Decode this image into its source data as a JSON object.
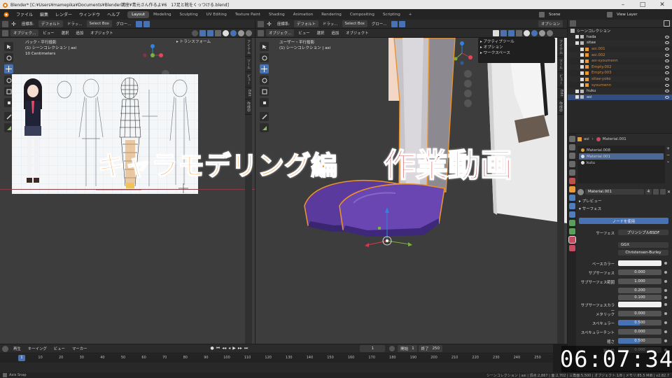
{
  "titlebar": {
    "title": "Blender* [C:¥Users¥mamepika¥Documents¥Blender講座¥青元さん作るよ¥6　17足と靴をくっつける.blend]"
  },
  "menubar": {
    "items": [
      "ファイル",
      "編集",
      "レンダー",
      "ウィンドウ",
      "ヘルプ"
    ],
    "workspaces": [
      "Layout",
      "Modeling",
      "Sculpting",
      "UV Editing",
      "Texture Paint",
      "Shading",
      "Animation",
      "Rendering",
      "Compositing",
      "Scripting",
      "+"
    ],
    "active_workspace": "Layout",
    "scene_label": "Scene",
    "view_layer_label": "View Layer"
  },
  "left_viewport": {
    "header": {
      "mode": "オブジェク…",
      "orientation_label": "座標系:",
      "orientation": "デフォルト",
      "drag": "ドラッ…",
      "select": "Select Box",
      "global": "グロー…",
      "menus": [
        "ビュー",
        "選択",
        "追加",
        "オブジェクト"
      ]
    },
    "info_lines": [
      "バック・平行投影",
      "(1) シーンコレクション | asi",
      "10 Centimeters"
    ],
    "transform_panel": "トランスフォーム",
    "side_tabs": [
      "アイテム",
      "ツール",
      "ビュー",
      "Edit",
      "作成中"
    ]
  },
  "right_viewport": {
    "header": {
      "mode": "オブジェク…",
      "orientation_label": "座標系:",
      "orientation": "デフォルト",
      "drag": "ドラッ…",
      "select": "Select Box",
      "global": "グロー…",
      "menus": [
        "ビュー",
        "選択",
        "追加",
        "オブジェクト"
      ],
      "options": "オプション"
    },
    "info_lines": [
      "ユーザー・平行投影",
      "(1) シーンコレクション | asi"
    ],
    "dropdown_items": [
      "アクティブツール",
      "オプション",
      "ワークスペース"
    ],
    "side_tabs": [
      "アイテム",
      "ツール",
      "ビュー",
      "Edit",
      "作成中"
    ]
  },
  "overlay": {
    "title_part1": "キャラモデリング編",
    "title_part2": "作業動画",
    "timestamp": "06:07:34"
  },
  "outliner": {
    "header": "シーンコレクション",
    "rows": [
      {
        "name": "hada",
        "indent": 1,
        "selected": false
      },
      {
        "name": "sitae",
        "indent": 1,
        "selected": false
      },
      {
        "name": "asi.001",
        "indent": 2,
        "selected": false
      },
      {
        "name": "asi.002",
        "indent": 2,
        "selected": false
      },
      {
        "name": "asi-syoumenn",
        "indent": 2,
        "selected": false
      },
      {
        "name": "Empty.002",
        "indent": 2,
        "selected": false
      },
      {
        "name": "Empty.003",
        "indent": 2,
        "selected": false
      },
      {
        "name": "sitae-yoko",
        "indent": 2,
        "selected": false
      },
      {
        "name": "syoumenn",
        "indent": 2,
        "selected": false
      },
      {
        "name": "huku",
        "indent": 1,
        "selected": false
      },
      {
        "name": "asi",
        "indent": 1,
        "selected": true
      }
    ]
  },
  "properties": {
    "object_name": "asi",
    "material_name": "Material.001",
    "slots": [
      "Material.008",
      "Material.001",
      "kutu"
    ],
    "material_field": "Material.001",
    "users": "4",
    "sections": [
      "プレビュー",
      "サーフェス"
    ],
    "use_nodes_button": "ノードを使用",
    "surface_label": "サーフェス",
    "surface_value": "プリンシプルBSDF",
    "distribution": "GGX",
    "subsurface_method": "Christensen-Burley",
    "params": [
      {
        "label": "ベースカラー",
        "value": "",
        "kind": "color"
      },
      {
        "label": "サブサーフェス",
        "value": "0.000",
        "kind": "num"
      },
      {
        "label": "サブサーフェス範囲",
        "value": "1.000",
        "kind": "num"
      },
      {
        "label": "",
        "value": "0.200",
        "kind": "num"
      },
      {
        "label": "",
        "value": "0.100",
        "kind": "num"
      },
      {
        "label": "サブサーフェスカラー",
        "value": "",
        "kind": "color"
      },
      {
        "label": "メタリック",
        "value": "0.000",
        "kind": "num"
      },
      {
        "label": "スペキュラー",
        "value": "0.500",
        "kind": "blue"
      },
      {
        "label": "スペキュラーチント",
        "value": "0.000",
        "kind": "num"
      },
      {
        "label": "粗さ",
        "value": "0.500",
        "kind": "blue"
      },
      {
        "label": "異方性",
        "value": "0.000",
        "kind": "num"
      }
    ]
  },
  "timeline": {
    "menus": [
      "再生",
      "キーイング",
      "ビュー",
      "マーカー"
    ],
    "current_frame": "1",
    "start_label": "開始",
    "start": "1",
    "end_label": "終了",
    "end": "250",
    "ticks": [
      "1",
      "10",
      "20",
      "30",
      "40",
      "50",
      "60",
      "70",
      "80",
      "90",
      "100",
      "110",
      "120",
      "130",
      "140",
      "150",
      "160",
      "170",
      "180",
      "190",
      "200",
      "210",
      "220",
      "230",
      "240",
      "250"
    ]
  },
  "statusbar": {
    "left": "Axis Snap",
    "right": "シーンコレクション | asi | 頂点:2,867 | 面:2,702 | 三角面:5,500 | オブジェクト:1/8 | メモリ:85.5 MiB | v2.82.7"
  }
}
